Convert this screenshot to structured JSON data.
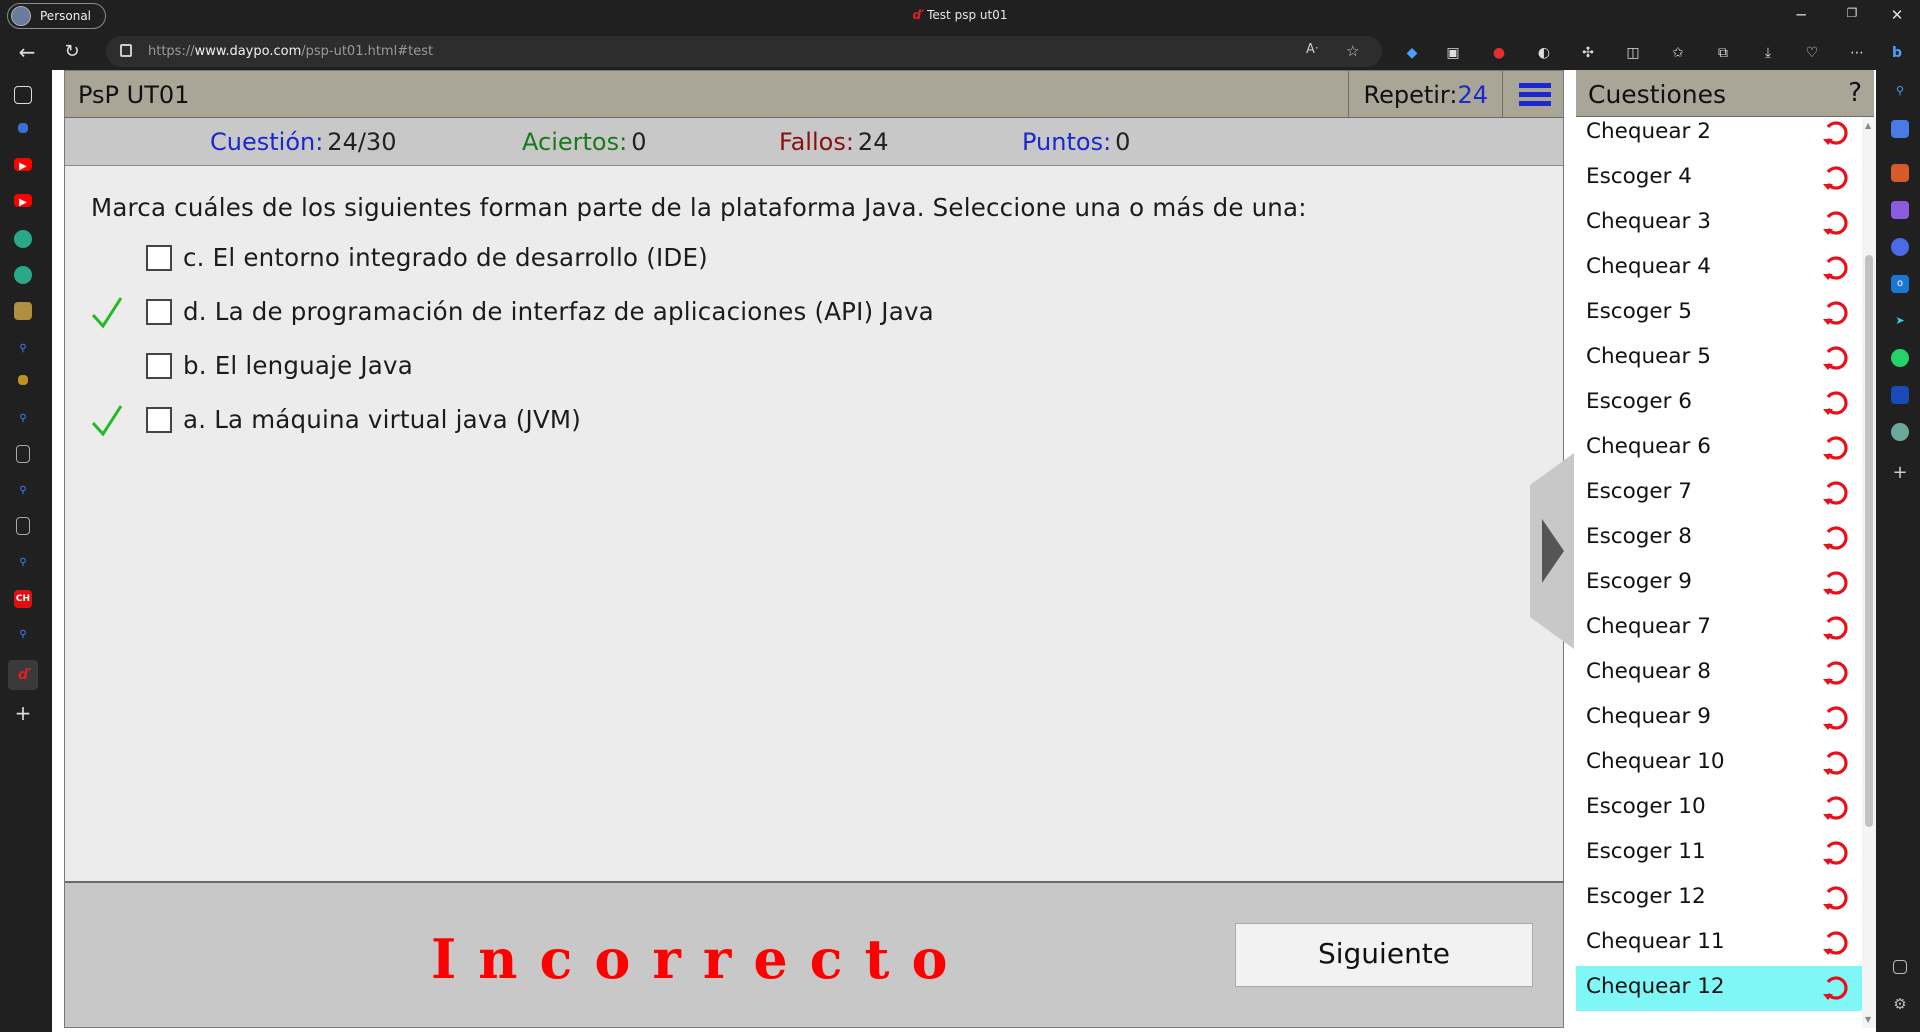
{
  "browser": {
    "profile_label": "Personal",
    "window_title": "Test psp ut01",
    "tab_favicon": "ď",
    "url_prefix": "https://",
    "url_domain": "www.daypo.com",
    "url_path": "/psp-ut01.html#test"
  },
  "quiz": {
    "title": "PsP UT01",
    "repetir_label": "Repetir:",
    "repetir_value": "24",
    "stats": {
      "cuestion_label": "Cuestión:",
      "cuestion_value": "24/30",
      "aciertos_label": "Aciertos:",
      "aciertos_value": "0",
      "fallos_label": "Fallos:",
      "fallos_value": "24",
      "puntos_label": "Puntos:",
      "puntos_value": "0"
    },
    "question": "Marca cuáles de los siguientes forman parte de la plataforma Java. Seleccione una o más de una:",
    "options": [
      {
        "text": "c. El entorno integrado de desarrollo (IDE)",
        "correct_mark": false
      },
      {
        "text": "d. La de programación de interfaz de aplicaciones (API) Java",
        "correct_mark": true
      },
      {
        "text": "b. El lenguaje Java",
        "correct_mark": false
      },
      {
        "text": "a. La máquina virtual java (JVM)",
        "correct_mark": true
      }
    ],
    "result": "Incorrecto",
    "next_label": "Siguiente"
  },
  "sidebar": {
    "title": "Cuestiones",
    "help": "?",
    "items": [
      "Chequear 2",
      "Escoger 4",
      "Chequear 3",
      "Chequear 4",
      "Escoger 5",
      "Chequear 5",
      "Escoger 6",
      "Chequear 6",
      "Escoger 7",
      "Escoger 8",
      "Escoger 9",
      "Chequear 7",
      "Chequear 8",
      "Chequear 9",
      "Chequear 10",
      "Escoger 10",
      "Escoger 11",
      "Escoger 12",
      "Chequear 11",
      "Chequear 12"
    ],
    "active_item": "Chequear 12"
  },
  "colors": {
    "header_bg": "#a9a597",
    "accent_blue": "#1a28d0",
    "result_red": "#ff0000",
    "active_row": "#7ff7f7",
    "redo_icon": "#e8101a",
    "check_green": "#22bb22"
  },
  "icons": {
    "left_tabs": [
      "tab-actions-icon",
      "tab-icon",
      "youtube-icon",
      "youtube-icon",
      "edge-icon",
      "edge-icon",
      "tab-icon",
      "search-icon",
      "tab-icon",
      "search-icon",
      "document-icon",
      "search-icon",
      "document-icon",
      "search-icon",
      "ch-icon",
      "search-icon",
      "daypo-icon",
      "new-tab-icon"
    ],
    "right_sidebar": [
      "search-icon",
      "tag-icon",
      "briefcase-icon",
      "games-icon",
      "office-icon",
      "outlook-icon",
      "send-icon",
      "whatsapp-icon",
      "cube-icon",
      "openai-icon",
      "add-icon"
    ]
  }
}
